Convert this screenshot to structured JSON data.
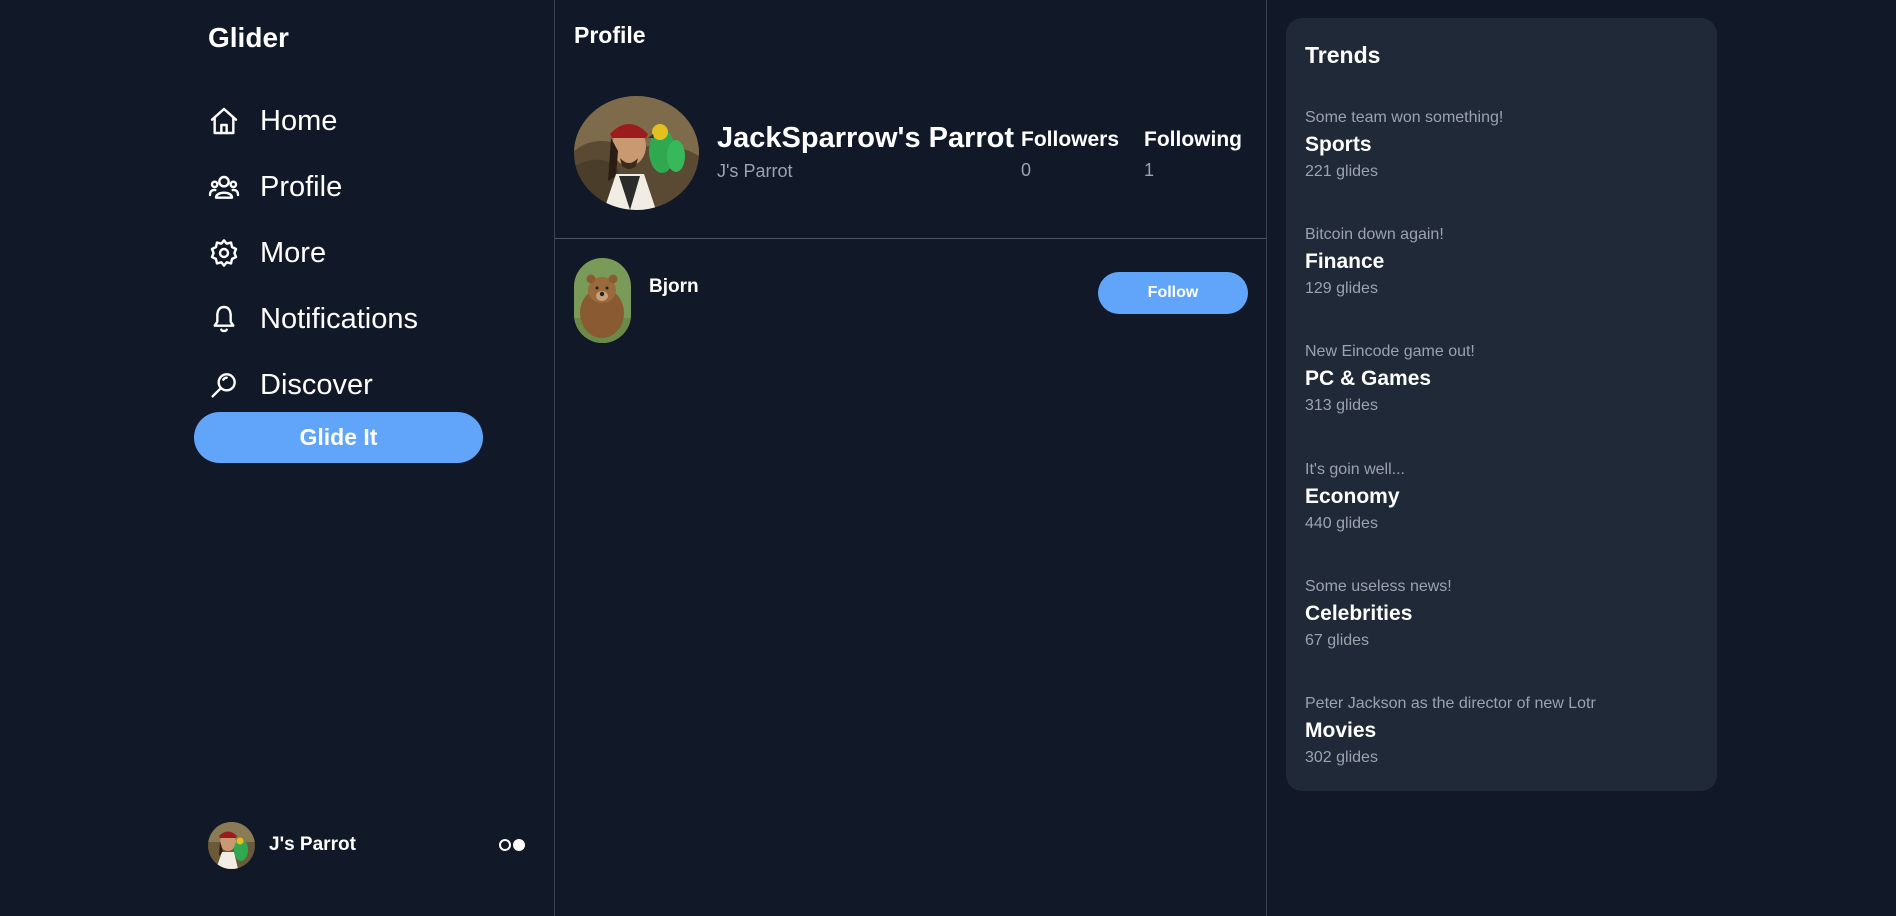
{
  "app": {
    "brand": "Glider"
  },
  "nav": [
    {
      "label": "Home",
      "icon": "home-icon"
    },
    {
      "label": "Profile",
      "icon": "users-icon"
    },
    {
      "label": "More",
      "icon": "gear-icon"
    },
    {
      "label": "Notifications",
      "icon": "bell-icon"
    },
    {
      "label": "Discover",
      "icon": "search-icon"
    }
  ],
  "glide_button": "Glide It",
  "current_user": {
    "name": "J's Parrot"
  },
  "main": {
    "title": "Profile",
    "profile": {
      "name": "JackSparrow's Parrot",
      "handle": "J's Parrot",
      "followers_label": "Followers",
      "followers_count": "0",
      "following_label": "Following",
      "following_count": "1"
    },
    "users": [
      {
        "name": "Bjorn",
        "button": "Follow"
      }
    ]
  },
  "trends": {
    "title": "Trends",
    "items": [
      {
        "subtitle": "Some team won something!",
        "category": "Sports",
        "count": "221 glides"
      },
      {
        "subtitle": "Bitcoin down again!",
        "category": "Finance",
        "count": "129 glides"
      },
      {
        "subtitle": "New Eincode game out!",
        "category": "PC & Games",
        "count": "313 glides"
      },
      {
        "subtitle": "It's goin well...",
        "category": "Economy",
        "count": "440 glides"
      },
      {
        "subtitle": "Some useless news!",
        "category": "Celebrities",
        "count": "67 glides"
      },
      {
        "subtitle": "Peter Jackson as the director of new Lotr",
        "category": "Movies",
        "count": "302 glides"
      }
    ]
  },
  "colors": {
    "background": "#111827",
    "panel": "#1f2937",
    "accent": "#60a5fa",
    "muted_text": "#9ca3af",
    "divider": "#374151"
  }
}
